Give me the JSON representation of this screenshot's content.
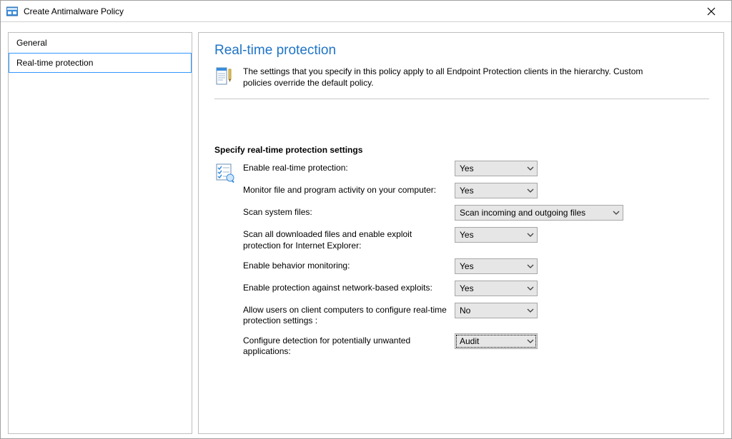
{
  "window": {
    "title": "Create Antimalware Policy"
  },
  "sidebar": {
    "items": [
      {
        "label": "General",
        "selected": false
      },
      {
        "label": "Real-time protection",
        "selected": true
      }
    ]
  },
  "main": {
    "title": "Real-time protection",
    "description": "The settings that you specify in this policy apply to all Endpoint Protection clients in the hierarchy. Custom policies override the default policy.",
    "section_heading": "Specify real-time protection settings",
    "settings": [
      {
        "label": "Enable real-time protection:",
        "value": "Yes",
        "width": "normal"
      },
      {
        "label": "Monitor file and program activity on your computer:",
        "value": "Yes",
        "width": "normal"
      },
      {
        "label": "Scan system files:",
        "value": "Scan incoming and outgoing files",
        "width": "wide"
      },
      {
        "label": "Scan all downloaded files and enable exploit protection for Internet Explorer:",
        "value": "Yes",
        "width": "normal"
      },
      {
        "label": "Enable behavior monitoring:",
        "value": "Yes",
        "width": "normal"
      },
      {
        "label": "Enable protection against network-based exploits:",
        "value": "Yes",
        "width": "normal"
      },
      {
        "label": "Allow users on client computers to configure real-time protection settings :",
        "value": "No",
        "width": "normal"
      },
      {
        "label": "Configure detection for potentially unwanted applications:",
        "value": "Audit",
        "width": "normal",
        "focused": true
      }
    ]
  },
  "icons": {
    "app": "app-icon",
    "close": "close-icon",
    "doc": "document-icon",
    "checklist": "checklist-icon",
    "chevron": "chevron-down-icon"
  },
  "colors": {
    "accent": "#1e74c7",
    "border": "#bfbfbf",
    "combo_bg": "#e6e6e6",
    "arrow": "#d40000"
  }
}
